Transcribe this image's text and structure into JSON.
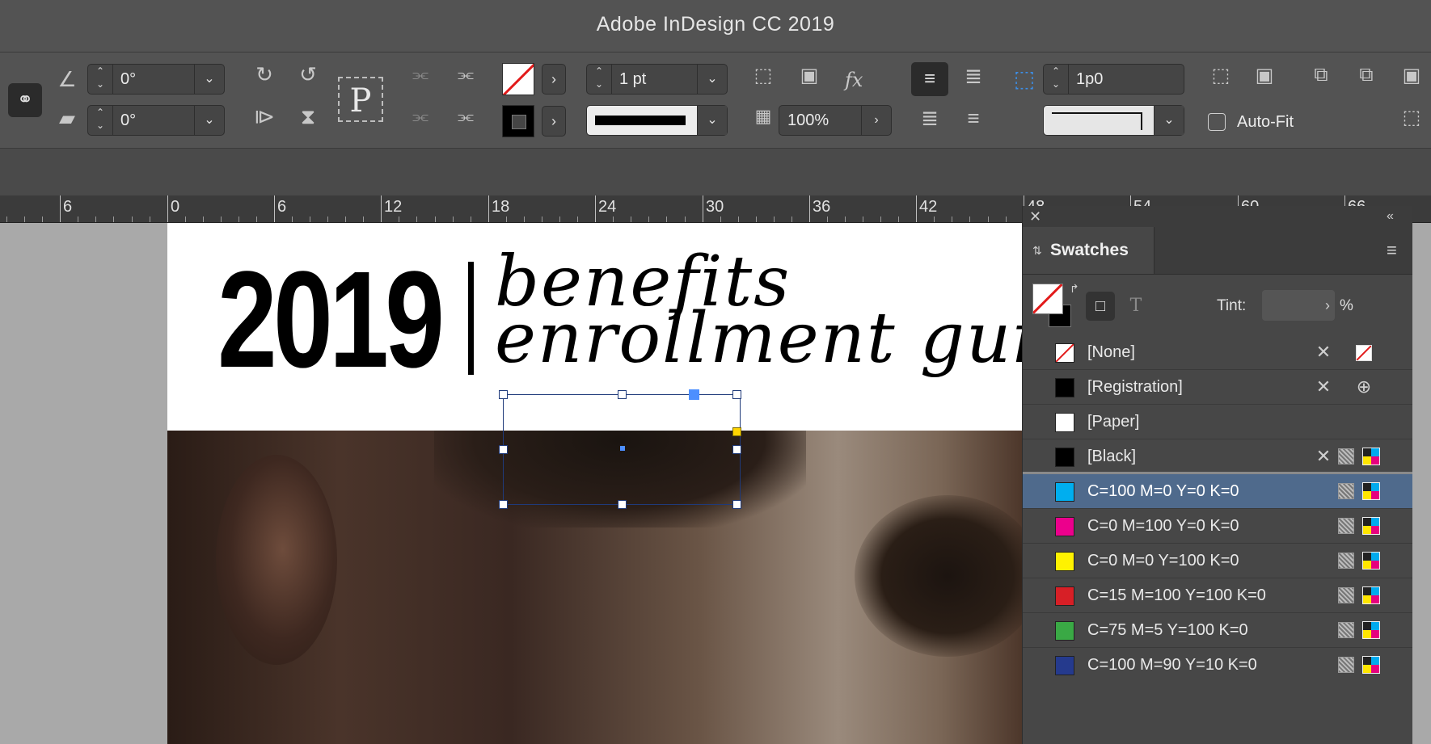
{
  "app": {
    "title": "Adobe InDesign CC 2019"
  },
  "controls": {
    "rotate_angle": "0°",
    "shear_angle": "0°",
    "reference_point_label": "P",
    "stroke_weight": "1 pt",
    "opacity": "100%",
    "fx_label": "fx",
    "gap_value": "1p0",
    "autofit_label": "Auto-Fit",
    "autofit_checked": false
  },
  "ruler": {
    "labels": [
      "6",
      "0",
      "6",
      "12",
      "18",
      "24",
      "30",
      "36",
      "42",
      "48",
      "54",
      "60",
      "66"
    ]
  },
  "document": {
    "year": "2019",
    "headline_line1": "benefits",
    "headline_line2": "enrollment guide"
  },
  "panel": {
    "tab_label": "Swatches",
    "tint_label": "Tint:",
    "tint_value": "",
    "tint_unit": "%",
    "swatches": [
      {
        "name": "[None]",
        "color": "none",
        "selected": false
      },
      {
        "name": "[Registration]",
        "color": "#000000",
        "selected": false
      },
      {
        "name": "[Paper]",
        "color": "#ffffff",
        "selected": false
      },
      {
        "name": "[Black]",
        "color": "#000000",
        "selected": false
      },
      {
        "name": "C=100 M=0 Y=0 K=0",
        "color": "#00aeef",
        "selected": true
      },
      {
        "name": "C=0 M=100 Y=0 K=0",
        "color": "#ec008c",
        "selected": false
      },
      {
        "name": "C=0 M=0 Y=100 K=0",
        "color": "#fff200",
        "selected": false
      },
      {
        "name": "C=15 M=100 Y=100 K=0",
        "color": "#d71f26",
        "selected": false
      },
      {
        "name": "C=75 M=5 Y=100 K=0",
        "color": "#3aa945",
        "selected": false
      },
      {
        "name": "C=100 M=90 Y=10 K=0",
        "color": "#253a8d",
        "selected": false
      }
    ]
  }
}
